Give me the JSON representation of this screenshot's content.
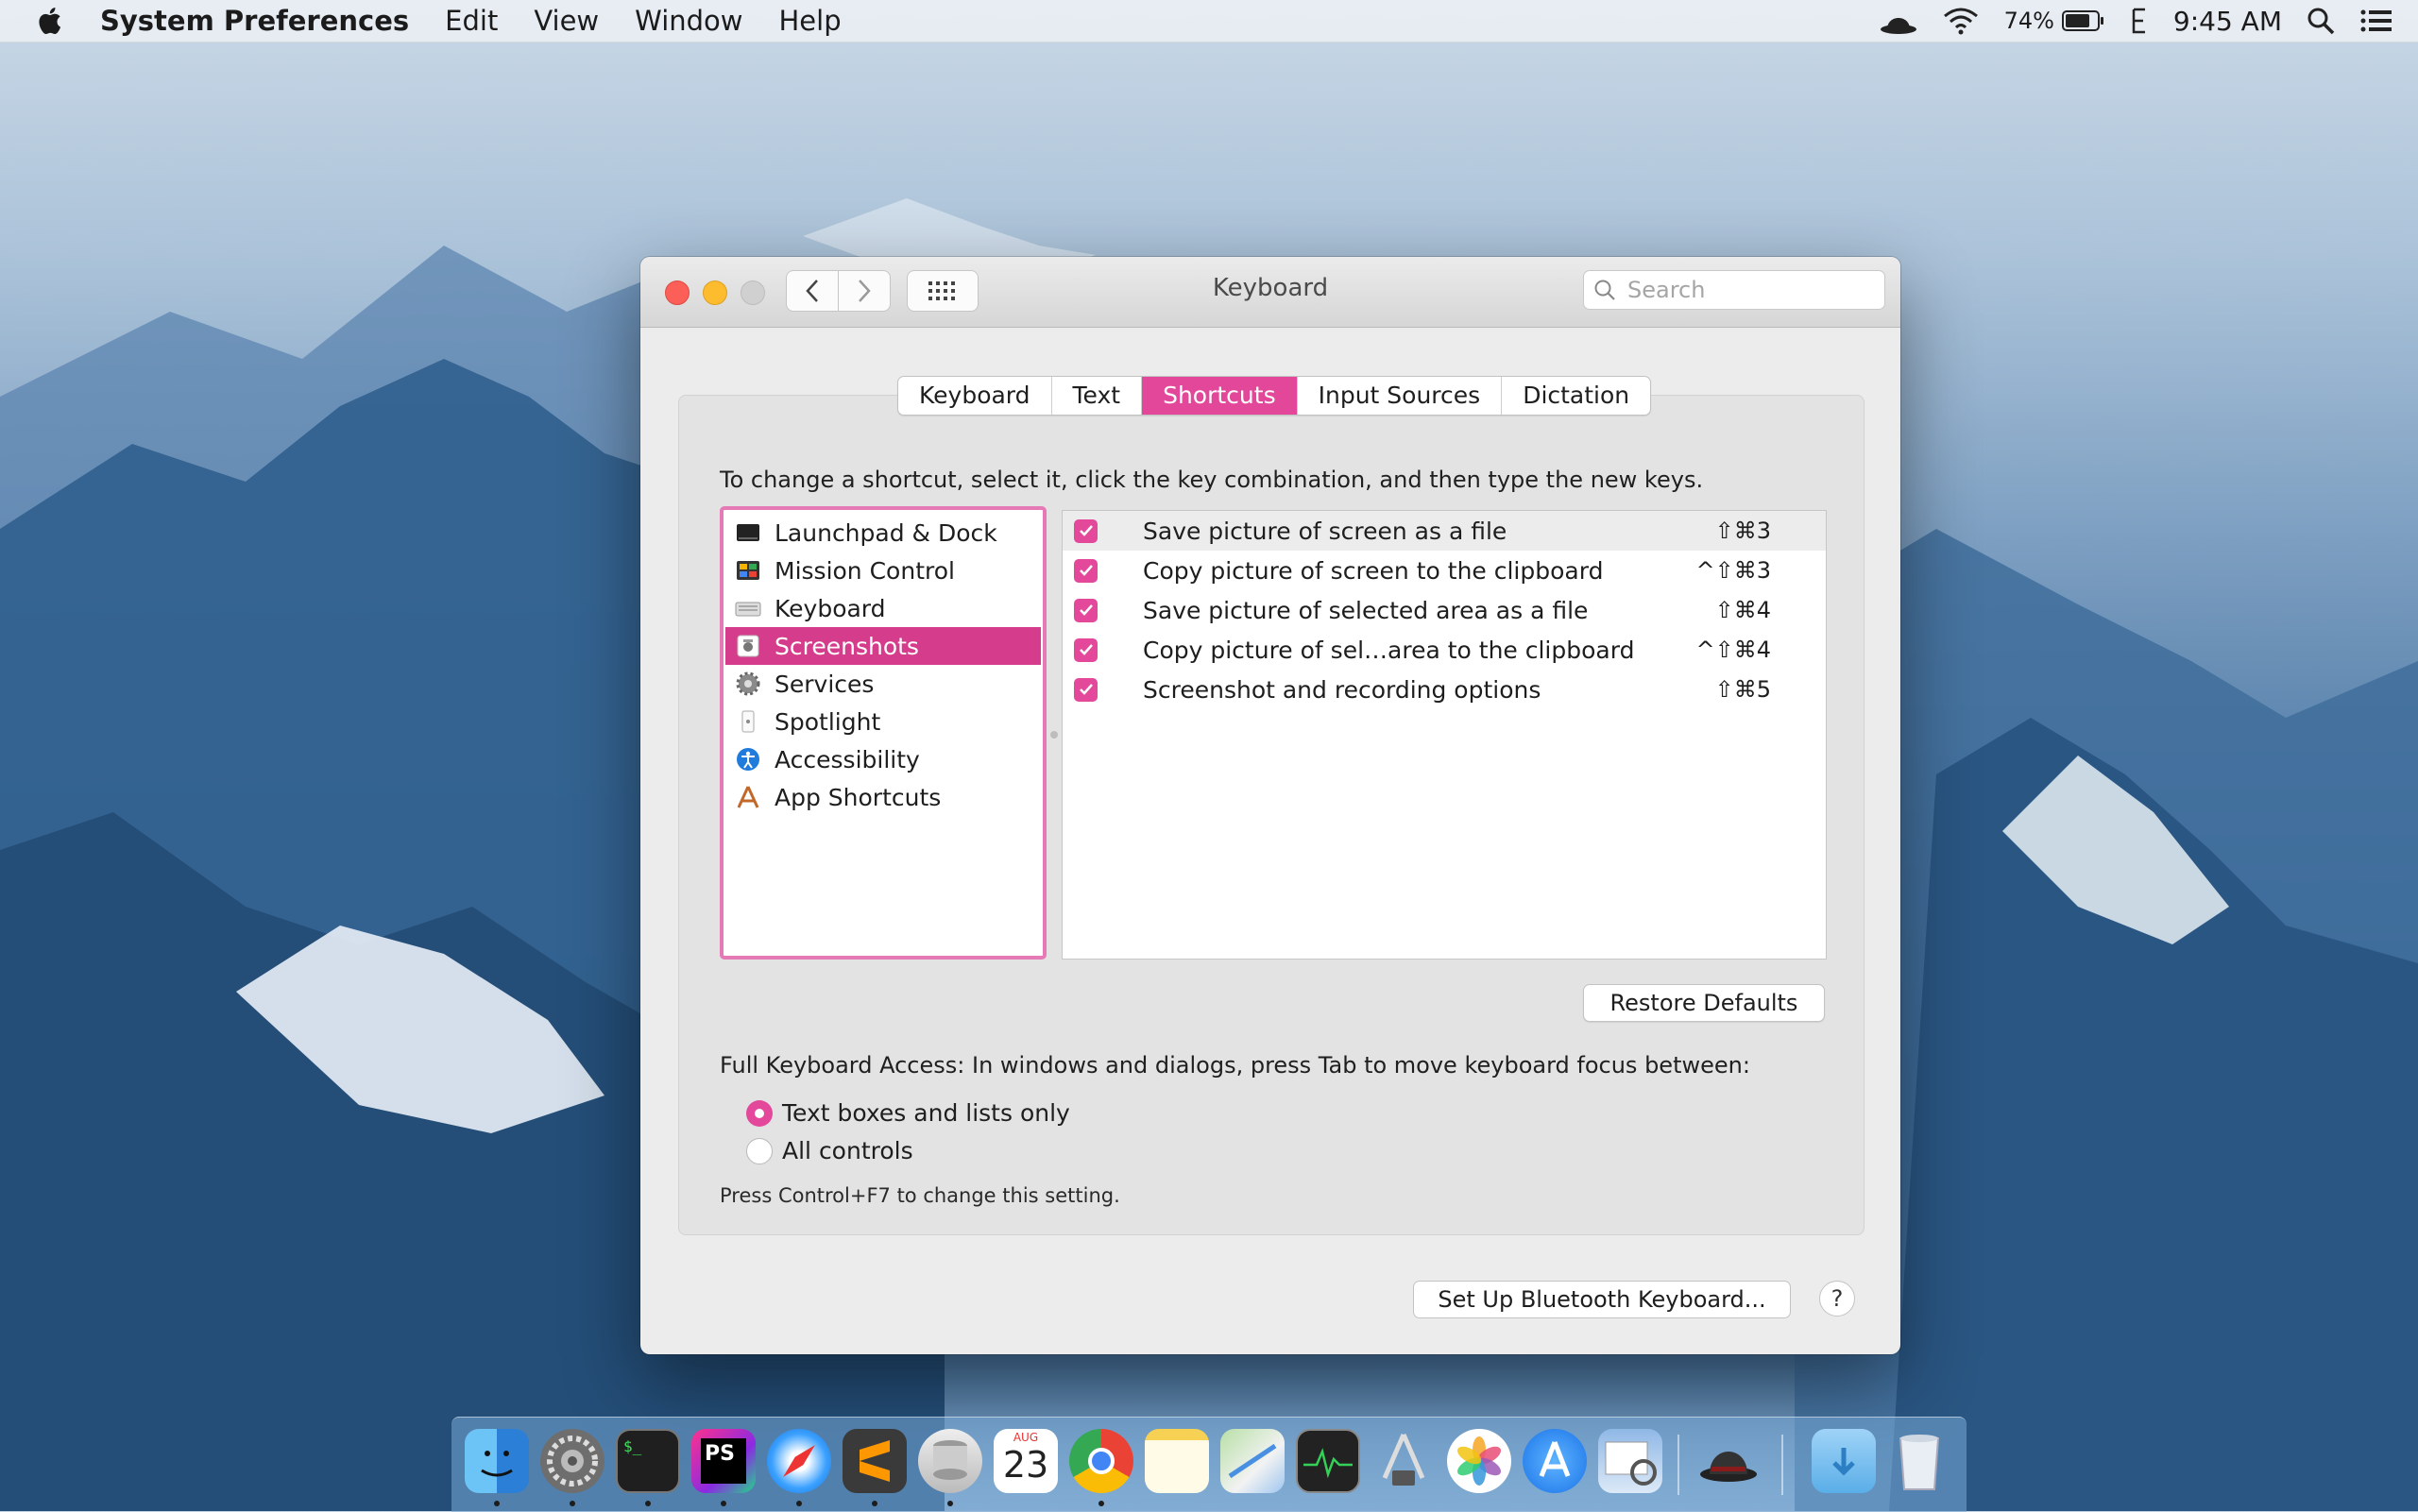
{
  "menubar": {
    "app_name": "System Preferences",
    "menus": [
      "Edit",
      "View",
      "Window",
      "Help"
    ],
    "battery": "74%",
    "time": "9:45 AM"
  },
  "window": {
    "title": "Keyboard",
    "search_placeholder": "Search"
  },
  "tabs": [
    {
      "label": "Keyboard",
      "active": false
    },
    {
      "label": "Text",
      "active": false
    },
    {
      "label": "Shortcuts",
      "active": true
    },
    {
      "label": "Input Sources",
      "active": false
    },
    {
      "label": "Dictation",
      "active": false
    }
  ],
  "instructions": "To change a shortcut, select it, click the key combination, and then type the new keys.",
  "categories": [
    {
      "label": "Launchpad & Dock",
      "icon": "launchpad-icon",
      "selected": false
    },
    {
      "label": "Mission Control",
      "icon": "mission-control-icon",
      "selected": false
    },
    {
      "label": "Keyboard",
      "icon": "keyboard-icon",
      "selected": false
    },
    {
      "label": "Screenshots",
      "icon": "screenshot-icon",
      "selected": true
    },
    {
      "label": "Services",
      "icon": "services-gear-icon",
      "selected": false
    },
    {
      "label": "Spotlight",
      "icon": "spotlight-icon",
      "selected": false
    },
    {
      "label": "Accessibility",
      "icon": "accessibility-icon",
      "selected": false
    },
    {
      "label": "App Shortcuts",
      "icon": "app-shortcuts-icon",
      "selected": false
    }
  ],
  "shortcuts": [
    {
      "label": "Save picture of screen as a file",
      "keys": "⇧⌘3",
      "checked": true
    },
    {
      "label": "Copy picture of screen to the clipboard",
      "keys": "^⇧⌘3",
      "checked": true
    },
    {
      "label": "Save picture of selected area as a file",
      "keys": "⇧⌘4",
      "checked": true
    },
    {
      "label": "Copy picture of sel…area to the clipboard",
      "keys": "^⇧⌘4",
      "checked": true
    },
    {
      "label": "Screenshot and recording options",
      "keys": "⇧⌘5",
      "checked": true
    }
  ],
  "restore_defaults": "Restore Defaults",
  "full_keyboard_access": {
    "label": "Full Keyboard Access: In windows and dialogs, press Tab to move keyboard focus between:",
    "options": [
      {
        "label": "Text boxes and lists only",
        "selected": true
      },
      {
        "label": "All controls",
        "selected": false
      }
    ],
    "note": "Press Control+F7 to change this setting."
  },
  "bluetooth_button": "Set Up Bluetooth Keyboard...",
  "help_button": "?",
  "accent_color": "#e3489b",
  "dock": {
    "calendar_month": "AUG",
    "calendar_day": "23",
    "apps": [
      "finder-icon",
      "system-preferences-icon",
      "terminal-icon",
      "phpstorm-icon",
      "safari-icon",
      "sublime-text-icon",
      "sequel-pro-icon",
      "calendar-icon",
      "chrome-icon",
      "notes-icon",
      "maps-icon",
      "activity-monitor-icon",
      "xcode-instruments-icon",
      "photos-icon",
      "app-store-icon",
      "preview-icon",
      "bartender-icon",
      "downloads-folder-icon",
      "trash-icon"
    ]
  }
}
